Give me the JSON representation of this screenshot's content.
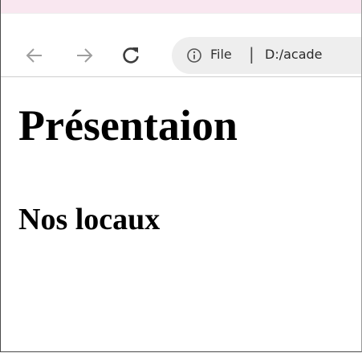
{
  "browser": {
    "back_icon": "back-arrow-icon",
    "forward_icon": "forward-arrow-icon",
    "reload_icon": "reload-icon",
    "site_info_icon": "info-icon",
    "omnibox": {
      "scheme_label": "File",
      "separator": "|",
      "url": "D:/acade"
    },
    "colors": {
      "tab_strip": "#f9e7f0",
      "omnibox_bg": "#eeeeee",
      "icon_gray": "#9e9e9e",
      "icon_dark": "#3c3c3c"
    }
  },
  "page": {
    "heading": "Présentaion",
    "subheading": "Nos locaux"
  }
}
